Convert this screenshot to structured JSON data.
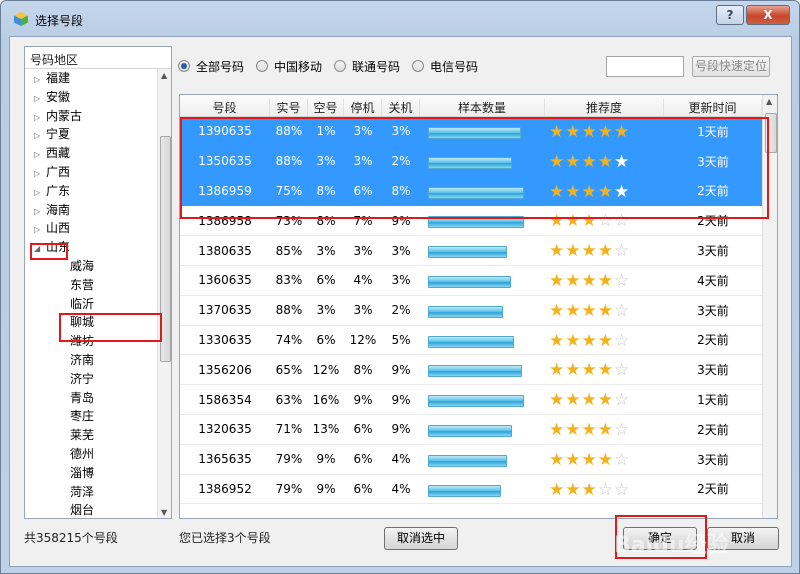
{
  "window": {
    "title": "选择号段",
    "help_label": "?",
    "close_label": "X"
  },
  "tree": {
    "header": "号码地区",
    "provinces": [
      "福建",
      "安徽",
      "内蒙古",
      "宁夏",
      "西藏",
      "广西",
      "广东",
      "海南",
      "山西"
    ],
    "expanded": "山东",
    "cities": [
      "威海",
      "东营",
      "临沂",
      "聊城",
      "潍坊",
      "济南",
      "济宁",
      "青岛",
      "枣庄",
      "莱芜",
      "德州",
      "淄博",
      "菏泽",
      "烟台"
    ],
    "selected_city": "聊城"
  },
  "filters": {
    "options": [
      "全部号码",
      "中国移动",
      "联通号码",
      "电信号码"
    ],
    "selected": "全部号码",
    "quick_input_value": "",
    "quick_button": "号段快速定位"
  },
  "grid": {
    "columns": [
      "号段",
      "实号",
      "空号",
      "停机",
      "关机",
      "样本数量",
      "推荐度",
      "更新时间"
    ],
    "rows": [
      {
        "prefix": "1390635",
        "real": "88%",
        "empty": "1%",
        "halt": "3%",
        "off": "3%",
        "sample": 0.93,
        "stars": 5,
        "updated": "1天前",
        "selected": true
      },
      {
        "prefix": "1350635",
        "real": "88%",
        "empty": "3%",
        "halt": "3%",
        "off": "2%",
        "sample": 0.84,
        "stars": 4,
        "updated": "3天前",
        "selected": true
      },
      {
        "prefix": "1386959",
        "real": "75%",
        "empty": "8%",
        "halt": "6%",
        "off": "8%",
        "sample": 0.96,
        "stars": 4,
        "updated": "2天前",
        "selected": true
      },
      {
        "prefix": "1386958",
        "real": "73%",
        "empty": "8%",
        "halt": "7%",
        "off": "9%",
        "sample": 0.96,
        "stars": 3,
        "updated": "2天前",
        "selected": false
      },
      {
        "prefix": "1380635",
        "real": "85%",
        "empty": "3%",
        "halt": "3%",
        "off": "3%",
        "sample": 0.79,
        "stars": 4,
        "updated": "3天前",
        "selected": false
      },
      {
        "prefix": "1360635",
        "real": "83%",
        "empty": "6%",
        "halt": "4%",
        "off": "3%",
        "sample": 0.83,
        "stars": 4,
        "updated": "4天前",
        "selected": false
      },
      {
        "prefix": "1370635",
        "real": "88%",
        "empty": "3%",
        "halt": "3%",
        "off": "2%",
        "sample": 0.75,
        "stars": 4,
        "updated": "3天前",
        "selected": false
      },
      {
        "prefix": "1330635",
        "real": "74%",
        "empty": "6%",
        "halt": "12%",
        "off": "5%",
        "sample": 0.86,
        "stars": 4,
        "updated": "2天前",
        "selected": false
      },
      {
        "prefix": "1356206",
        "real": "65%",
        "empty": "12%",
        "halt": "8%",
        "off": "9%",
        "sample": 0.94,
        "stars": 4,
        "updated": "3天前",
        "selected": false
      },
      {
        "prefix": "1586354",
        "real": "63%",
        "empty": "16%",
        "halt": "9%",
        "off": "9%",
        "sample": 0.96,
        "stars": 4,
        "updated": "1天前",
        "selected": false
      },
      {
        "prefix": "1320635",
        "real": "71%",
        "empty": "13%",
        "halt": "6%",
        "off": "9%",
        "sample": 0.84,
        "stars": 4,
        "updated": "2天前",
        "selected": false
      },
      {
        "prefix": "1365635",
        "real": "79%",
        "empty": "9%",
        "halt": "6%",
        "off": "4%",
        "sample": 0.79,
        "stars": 4,
        "updated": "3天前",
        "selected": false
      },
      {
        "prefix": "1386952",
        "real": "79%",
        "empty": "9%",
        "halt": "6%",
        "off": "4%",
        "sample": 0.73,
        "stars": 3,
        "updated": "2天前",
        "selected": false
      }
    ]
  },
  "footer": {
    "total": "共358215个号段",
    "selected_count": "您已选择3个号段",
    "clear_button": "取消选中",
    "ok_button": "确定",
    "cancel_button": "取消"
  },
  "watermark": "Baidu经验",
  "colors": {
    "selection": "#3399ff",
    "star": "#f2b21b",
    "highlight": "#e0191b"
  }
}
